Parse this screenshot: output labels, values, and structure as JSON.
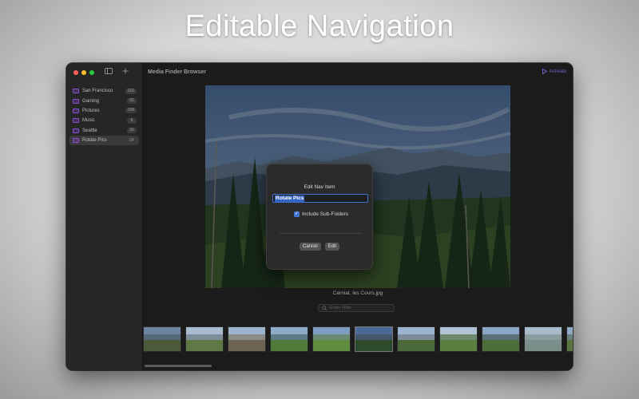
{
  "headline": "Editable Navigation",
  "window": {
    "title": "Media Finder Browser",
    "activate_label": "Activate",
    "accent": "#7b5fc9",
    "traffic_colors": [
      "#ff5f57",
      "#febc2e",
      "#28c840"
    ]
  },
  "toolbar": {
    "sidebar_toggle_icon": "sidebar-toggle-icon",
    "add_icon": "plus-icon"
  },
  "sidebar": {
    "items": [
      {
        "label": "San Francisco",
        "count": "316",
        "icon": "folder-icon"
      },
      {
        "label": "Gaming",
        "count": "82",
        "icon": "folder-icon"
      },
      {
        "label": "Pictures",
        "count": "168",
        "icon": "folder-icon"
      },
      {
        "label": "Music",
        "count": "8",
        "icon": "folder-icon"
      },
      {
        "label": "Seattle",
        "count": "26",
        "icon": "folder-icon"
      },
      {
        "label": "Rotate Pics",
        "count": "64",
        "icon": "folder-icon",
        "selected": true
      }
    ]
  },
  "viewer": {
    "caption": "Cerniat, les Cours.jpg"
  },
  "filter": {
    "placeholder": "Enter Filter",
    "icon": "search-icon"
  },
  "dialog": {
    "title": "Edit Nav Item",
    "name_value": "Rotate Pics",
    "checkbox_label": "Include Sub-Folders",
    "checkbox_checked": true,
    "cancel_label": "Cancel",
    "confirm_label": "Edit"
  }
}
